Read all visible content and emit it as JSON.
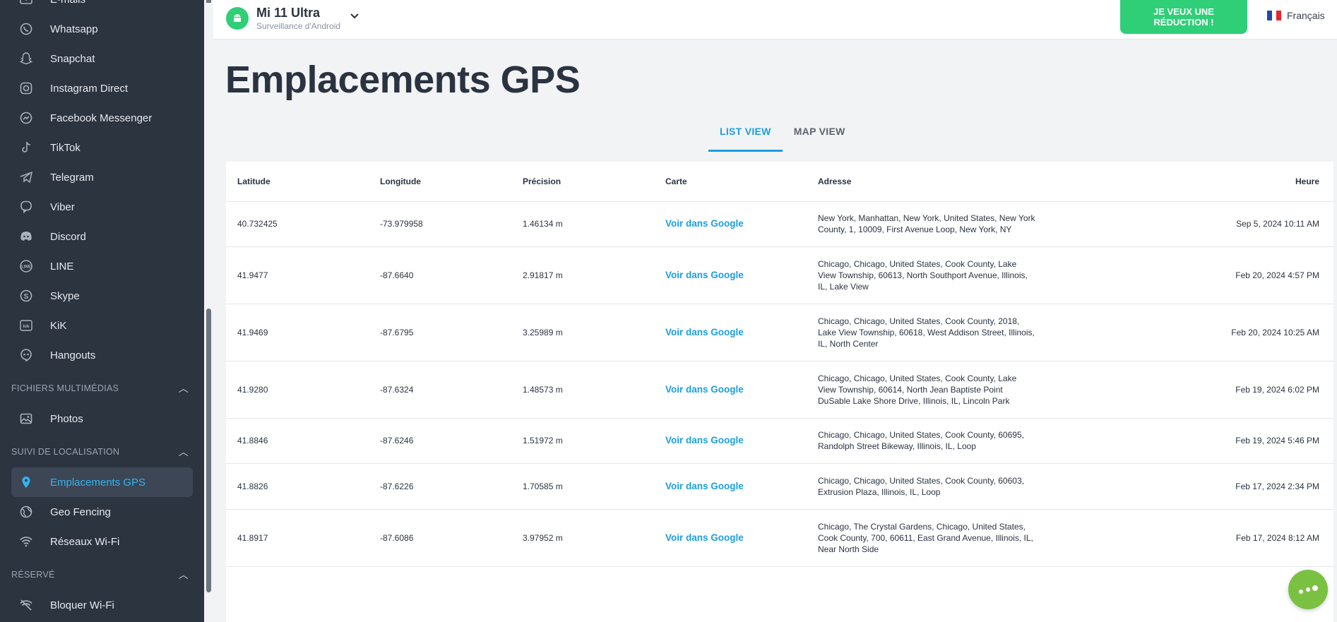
{
  "sidebar": {
    "items_top": [
      {
        "label": "E-mails",
        "icon": "mail-icon"
      },
      {
        "label": "Whatsapp",
        "icon": "whatsapp-icon"
      },
      {
        "label": "Snapchat",
        "icon": "snapchat-icon"
      },
      {
        "label": "Instagram Direct",
        "icon": "instagram-icon"
      },
      {
        "label": "Facebook Messenger",
        "icon": "messenger-icon"
      },
      {
        "label": "TikTok",
        "icon": "tiktok-icon"
      },
      {
        "label": "Telegram",
        "icon": "telegram-icon"
      },
      {
        "label": "Viber",
        "icon": "viber-icon"
      },
      {
        "label": "Discord",
        "icon": "discord-icon"
      },
      {
        "label": "LINE",
        "icon": "line-icon"
      },
      {
        "label": "Skype",
        "icon": "skype-icon"
      },
      {
        "label": "KiK",
        "icon": "kik-icon"
      },
      {
        "label": "Hangouts",
        "icon": "hangouts-icon"
      }
    ],
    "section_media": "FICHIERS MULTIMÉDIAS",
    "media_items": [
      {
        "label": "Photos",
        "icon": "photos-icon"
      }
    ],
    "section_location": "SUIVI DE LOCALISATION",
    "location_items": [
      {
        "label": "Emplacements GPS",
        "icon": "location-pin-icon",
        "active": true
      },
      {
        "label": "Geo Fencing",
        "icon": "globe-icon"
      },
      {
        "label": "Réseaux Wi-Fi",
        "icon": "wifi-icon"
      }
    ],
    "section_reserved": "RÉSERVÉ",
    "reserved_items": [
      {
        "label": "Bloquer Wi-Fi",
        "icon": "wifi-off-icon"
      }
    ]
  },
  "header": {
    "device_name": "Mi 11 Ultra",
    "device_sub": "Surveillance d'Android",
    "promo_label": "JE VEUX UNE RÉDUCTION !",
    "language": "Français"
  },
  "main": {
    "title": "Emplacements GPS",
    "tabs": [
      {
        "label": "LIST VIEW",
        "active": true
      },
      {
        "label": "MAP VIEW",
        "active": false
      }
    ],
    "columns": [
      "Latitude",
      "Longitude",
      "Précision",
      "Carte",
      "Adresse",
      "Heure"
    ],
    "rows": [
      {
        "lat": "40.732425",
        "lon": "-73.979958",
        "prec": "1.46134 m",
        "map": "Voir dans Google",
        "addr": "New York, Manhattan, New York, United States, New York County, 1, 10009, First Avenue Loop, New York, NY",
        "time": "Sep 5, 2024 10:11 AM"
      },
      {
        "lat": "41.9477",
        "lon": "-87.6640",
        "prec": "2.91817 m",
        "map": "Voir dans Google",
        "addr": "Chicago, Chicago, United States, Cook County, Lake View Township, 60613, North Southport Avenue, Illinois, IL, Lake View",
        "time": "Feb 20, 2024 4:57 PM"
      },
      {
        "lat": "41.9469",
        "lon": "-87.6795",
        "prec": "3.25989 m",
        "map": "Voir dans Google",
        "addr": "Chicago, Chicago, United States, Cook County, 2018, Lake View Township, 60618, West Addison Street, Illinois, IL, North Center",
        "time": "Feb 20, 2024 10:25 AM"
      },
      {
        "lat": "41.9280",
        "lon": "-87.6324",
        "prec": "1.48573 m",
        "map": "Voir dans Google",
        "addr": "Chicago, Chicago, United States, Cook County, Lake View Township, 60614, North Jean Baptiste Point DuSable Lake Shore Drive, Illinois, IL, Lincoln Park",
        "time": "Feb 19, 2024 6:02 PM"
      },
      {
        "lat": "41.8846",
        "lon": "-87.6246",
        "prec": "1.51972 m",
        "map": "Voir dans Google",
        "addr": "Chicago, Chicago, United States, Cook County, 60695, Randolph Street Bikeway, Illinois, IL, Loop",
        "time": "Feb 19, 2024 5:46 PM"
      },
      {
        "lat": "41.8826",
        "lon": "-87.6226",
        "prec": "1.70585 m",
        "map": "Voir dans Google",
        "addr": "Chicago, Chicago, United States, Cook County, 60603, Extrusion Plaza, Illinois, IL, Loop",
        "time": "Feb 17, 2024 2:34 PM"
      },
      {
        "lat": "41.8917",
        "lon": "-87.6086",
        "prec": "3.97952 m",
        "map": "Voir dans Google",
        "addr": "Chicago, The Crystal Gardens, Chicago, United States, Cook County, 700, 60611, East Grand Avenue, Illinois, IL, Near North Side",
        "time": "Feb 17, 2024 8:12 AM"
      }
    ]
  },
  "colors": {
    "accent": "#1a9fe0",
    "promo": "#2fcf77",
    "sidebar_bg": "#2c3440",
    "fab": "#7ac142"
  }
}
